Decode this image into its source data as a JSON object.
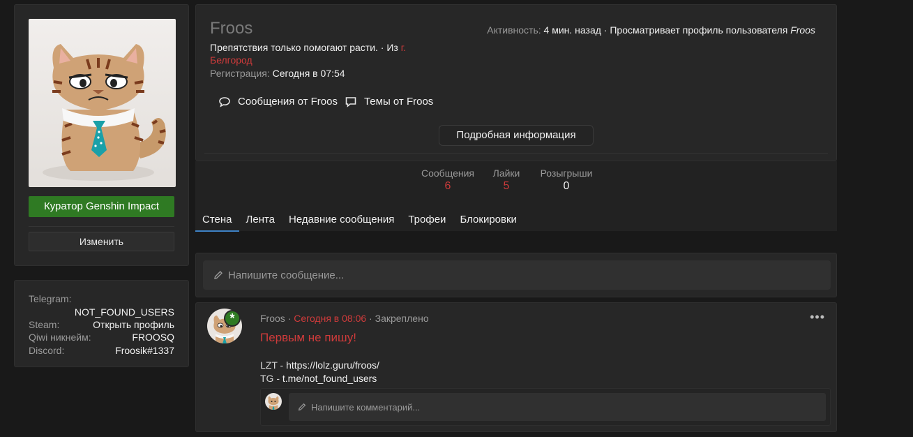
{
  "sidebar": {
    "curator_badge": "Куратор Genshin Impact",
    "edit_label": "Изменить",
    "contacts": [
      {
        "label": "Telegram:",
        "value": "NOT_FOUND_USERS"
      },
      {
        "label": "Steam:",
        "value": "Открыть профиль"
      },
      {
        "label": "Qiwi никнейм:",
        "value": "FROOSQ"
      },
      {
        "label": "Discord:",
        "value": "Froosik#1337"
      }
    ]
  },
  "profile": {
    "username": "Froos",
    "status_text": "Препятствия только помогают расти. · Из ",
    "location": "г. Белгород",
    "registration_label": "Регистрация:",
    "registration_value": "Сегодня в 07:54",
    "activity_label": "Активность:",
    "activity_value": "4 мин. назад · Просматривает профиль пользователя",
    "activity_target": "Froos",
    "link_messages": "Сообщения от Froos",
    "link_threads": "Темы от Froos",
    "details_button": "Подробная информация"
  },
  "counters": [
    {
      "label": "Сообщения",
      "value": "6"
    },
    {
      "label": "Лайки",
      "value": "5"
    },
    {
      "label": "Розыгрыши",
      "value": "0"
    }
  ],
  "tabs": [
    "Стена",
    "Лента",
    "Недавние сообщения",
    "Трофеи",
    "Блокировки"
  ],
  "composer": {
    "placeholder": "Напишите сообщение..."
  },
  "post": {
    "author": "Froos",
    "time": "Сегодня в 08:06",
    "pinned": "Закреплено",
    "title": "Первым не пишу!",
    "line1_key": "LZT - ",
    "line1_val": "https://lolz.guru/froos/",
    "line2_key": "TG - ",
    "line2_val": "t.me/not_found_users",
    "menu": "•••",
    "comment_placeholder": "Напишите комментарий..."
  },
  "colors": {
    "accent_red": "#cf3b3b",
    "badge_green": "#2f7a23",
    "tab_active": "#3e82c5"
  }
}
